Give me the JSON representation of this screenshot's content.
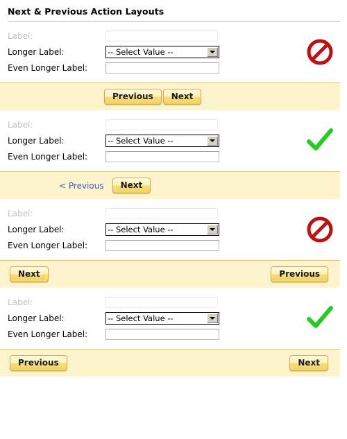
{
  "page": {
    "title": "Next & Previous Action Layouts"
  },
  "form": {
    "fields": [
      {
        "label": "Label:",
        "type": "text",
        "value": "",
        "placeholder": ""
      },
      {
        "label": "Longer Label:",
        "type": "select",
        "value": "-- Select Value --"
      },
      {
        "label": "Even Longer Label:",
        "type": "text",
        "value": "",
        "placeholder": ""
      }
    ]
  },
  "labels": {
    "previous": "Previous",
    "next": "Next",
    "previous_link": "< Previous"
  },
  "sections": [
    {
      "id": "section-1",
      "status": "not-recommended",
      "status_icon": "prohibition-icon",
      "layout": "centered-previous-next",
      "buttons": [
        {
          "name": "previous-button",
          "label": "Previous",
          "style": "button"
        },
        {
          "name": "next-button",
          "label": "Next",
          "style": "button"
        }
      ]
    },
    {
      "id": "section-2",
      "status": "recommended",
      "status_icon": "checkmark-icon",
      "layout": "centered-link-previous-next-button",
      "buttons": [
        {
          "name": "previous-link",
          "label": "< Previous",
          "style": "link"
        },
        {
          "name": "next-button",
          "label": "Next",
          "style": "button"
        }
      ]
    },
    {
      "id": "section-3",
      "status": "not-recommended",
      "status_icon": "prohibition-icon",
      "layout": "spread-next-left-previous-right",
      "buttons": [
        {
          "name": "next-button",
          "label": "Next",
          "style": "button"
        },
        {
          "name": "previous-button",
          "label": "Previous",
          "style": "button"
        }
      ]
    },
    {
      "id": "section-4",
      "status": "recommended",
      "status_icon": "checkmark-icon",
      "layout": "spread-previous-left-next-right",
      "buttons": [
        {
          "name": "previous-button",
          "label": "Previous",
          "style": "button"
        },
        {
          "name": "next-button",
          "label": "Next",
          "style": "button"
        }
      ]
    }
  ],
  "colors": {
    "action_bar_bg": "#fdf3cd",
    "action_bar_border": "#e8c45a",
    "button_border": "#d2a93c",
    "link": "#3a5fbd",
    "prohibition": "#bb1111",
    "checkmark": "#22cc22"
  }
}
